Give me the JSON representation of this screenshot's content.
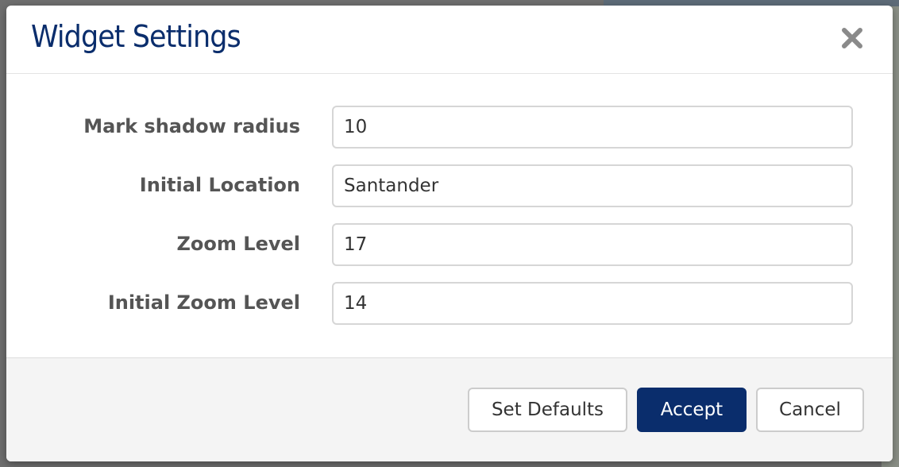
{
  "dialog": {
    "title": "Widget Settings",
    "close_icon": "close-icon"
  },
  "form": {
    "fields": [
      {
        "label": "Mark shadow radius",
        "value": "10"
      },
      {
        "label": "Initial Location",
        "value": "Santander"
      },
      {
        "label": "Zoom Level",
        "value": "17"
      },
      {
        "label": "Initial Zoom Level",
        "value": "14"
      }
    ]
  },
  "footer": {
    "set_defaults_label": "Set Defaults",
    "accept_label": "Accept",
    "cancel_label": "Cancel"
  },
  "colors": {
    "accent": "#0a2d6c",
    "label_text": "#555555",
    "footer_bg": "#f4f4f4"
  }
}
